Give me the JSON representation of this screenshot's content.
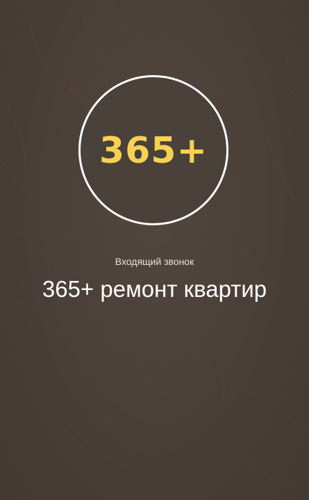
{
  "call": {
    "status": "Входящий звонок",
    "caller_name": "365+ ремонт квартир",
    "avatar_logo": "365+"
  },
  "colors": {
    "background": "#4a3f39",
    "logo": "#f7d154",
    "ring": "#ffffff",
    "text": "#ffffff"
  },
  "icons": {
    "background": "marble-texture"
  }
}
